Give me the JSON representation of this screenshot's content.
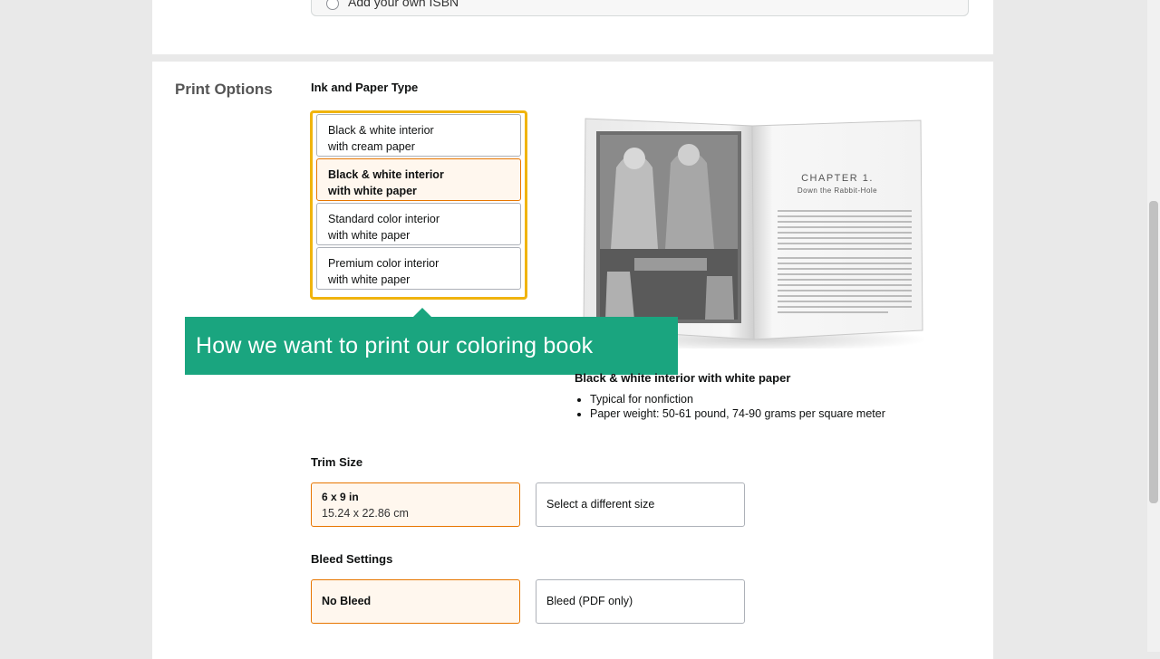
{
  "isbn": {
    "option_label": "Add your own ISBN"
  },
  "print_options": {
    "section_title": "Print Options",
    "ink_paper_label": "Ink and Paper Type",
    "paper_options": [
      {
        "line1": "Black & white interior",
        "line2": "with cream paper"
      },
      {
        "line1": "Black & white interior",
        "line2": "with white paper"
      },
      {
        "line1": "Standard color interior",
        "line2": "with white paper"
      },
      {
        "line1": "Premium color interior",
        "line2": "with white paper"
      }
    ],
    "selected_paper_index": 1
  },
  "preview": {
    "chapter_title": "CHAPTER 1.",
    "chapter_subtitle": "Down the Rabbit-Hole"
  },
  "caption": {
    "text": "How we want to print our coloring book"
  },
  "description": {
    "title": "Black & white interior with white paper",
    "bullets": [
      "Typical for nonfiction",
      "Paper weight: 50-61 pound, 74-90 grams per square meter"
    ]
  },
  "trim_size": {
    "label": "Trim Size",
    "selected_main": "6 x 9 in",
    "selected_sub": "15.24 x 22.86 cm",
    "alternate": "Select a different size"
  },
  "bleed": {
    "label": "Bleed Settings",
    "selected": "No Bleed",
    "alternate": "Bleed (PDF only)"
  },
  "colors": {
    "highlight_border": "#f0b40e",
    "selected_border": "#e77600",
    "selected_bg": "#fff7ee",
    "caption_bg": "#1aa57f"
  }
}
